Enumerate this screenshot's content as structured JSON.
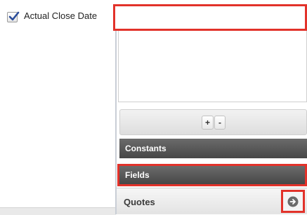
{
  "field_row": {
    "label": "Actual Close Date",
    "checked": true
  },
  "formula_builder": {
    "input_value": "",
    "buttons": {
      "plus": "+",
      "minus": "-"
    },
    "sections": {
      "constants": "Constants",
      "fields": "Fields"
    },
    "list_items": [
      {
        "label": "Quotes",
        "icon": "arrow-right-circle-icon"
      }
    ]
  },
  "colors": {
    "highlight": "#e2322a",
    "header_bg": "#555555",
    "panel_border": "#c9ced6"
  }
}
